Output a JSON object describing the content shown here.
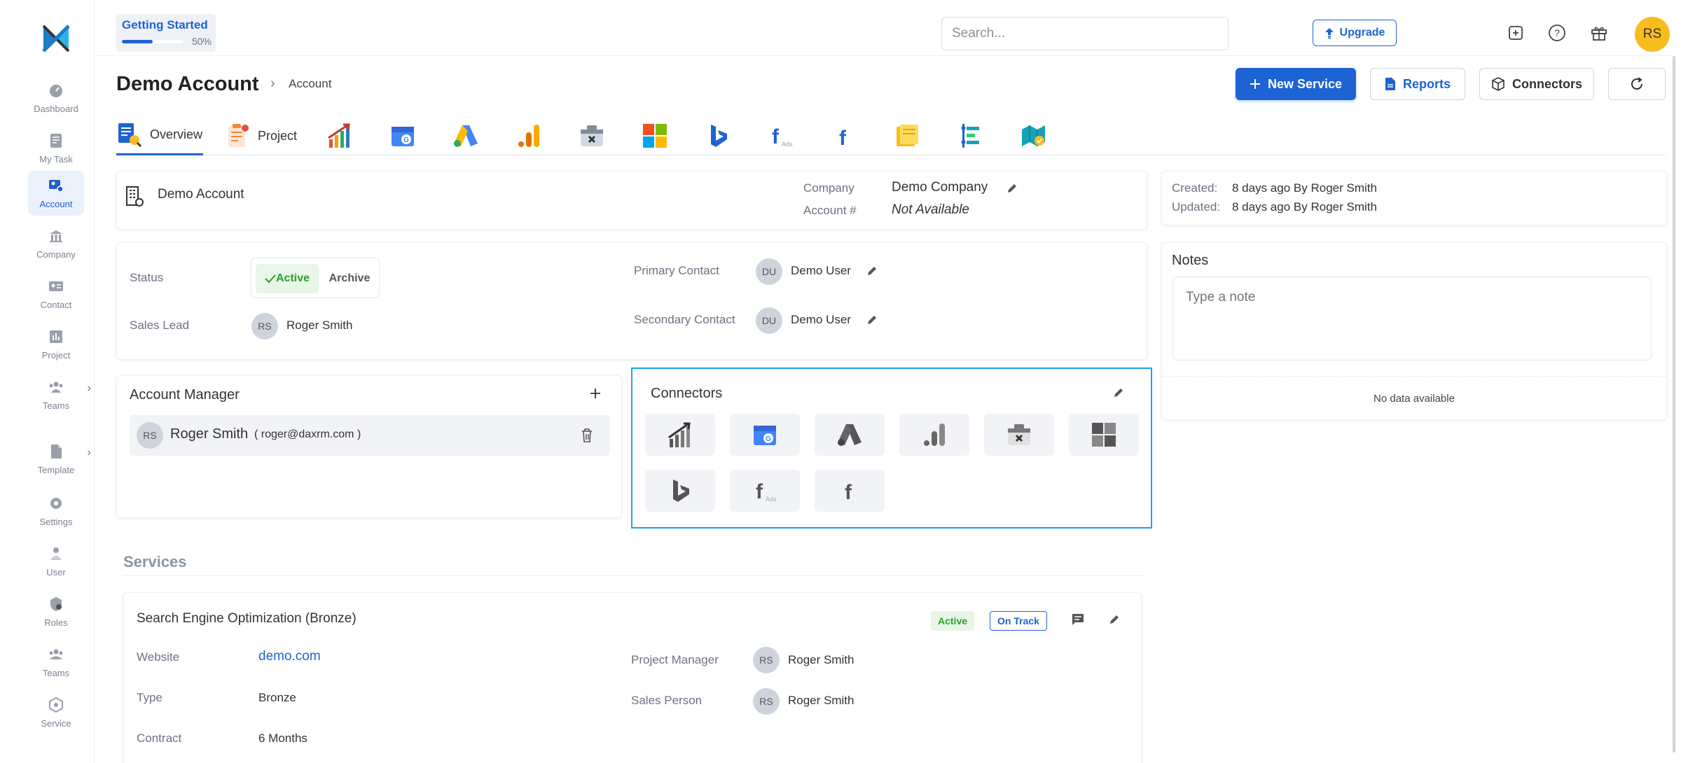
{
  "sidebar": {
    "items": [
      {
        "label": "Dashboard",
        "icon": "dashboard-icon",
        "active": false,
        "arrow": false
      },
      {
        "label": "My Task",
        "icon": "task-icon",
        "active": false,
        "arrow": false
      },
      {
        "label": "Account",
        "icon": "account-icon",
        "active": true,
        "arrow": false
      },
      {
        "label": "Company",
        "icon": "company-icon",
        "active": false,
        "arrow": false
      },
      {
        "label": "Contact",
        "icon": "contact-icon",
        "active": false,
        "arrow": false
      },
      {
        "label": "Project",
        "icon": "project-icon",
        "active": false,
        "arrow": false
      },
      {
        "label": "Teams",
        "icon": "teams-icon",
        "active": false,
        "arrow": true
      },
      {
        "label": "Template",
        "icon": "template-icon",
        "active": false,
        "arrow": true
      },
      {
        "label": "Settings",
        "icon": "settings-icon",
        "active": false,
        "arrow": false
      },
      {
        "label": "User",
        "icon": "user-icon",
        "active": false,
        "arrow": false
      },
      {
        "label": "Roles",
        "icon": "roles-icon",
        "active": false,
        "arrow": false
      },
      {
        "label": "Teams",
        "icon": "teams-icon",
        "active": false,
        "arrow": false
      },
      {
        "label": "Service",
        "icon": "service-icon",
        "active": false,
        "arrow": false
      }
    ]
  },
  "topbar": {
    "getting_started": {
      "title": "Getting Started",
      "progress": "50%"
    },
    "search_placeholder": "Search...",
    "upgrade_label": "Upgrade",
    "user_initials": "RS"
  },
  "page": {
    "title": "Demo Account",
    "breadcrumb_sep": "›",
    "breadcrumb": "Account",
    "buttons": {
      "new_service": "New Service",
      "reports": "Reports",
      "connectors": "Connectors"
    }
  },
  "tabs": [
    {
      "label": "Overview",
      "icon": "overview-icon",
      "active": true
    },
    {
      "label": "Project",
      "icon": "project-clipboard-icon",
      "active": false
    },
    {
      "label": "",
      "icon": "analytics-growth-icon"
    },
    {
      "label": "",
      "icon": "google-business-icon"
    },
    {
      "label": "",
      "icon": "google-ads-icon"
    },
    {
      "label": "",
      "icon": "google-analytics-icon"
    },
    {
      "label": "",
      "icon": "tag-manager-icon"
    },
    {
      "label": "",
      "icon": "microsoft-icon"
    },
    {
      "label": "",
      "icon": "bing-icon"
    },
    {
      "label": "",
      "icon": "facebook-ads-icon"
    },
    {
      "label": "",
      "icon": "facebook-icon"
    },
    {
      "label": "",
      "icon": "folder-icon"
    },
    {
      "label": "",
      "icon": "timeline-icon"
    },
    {
      "label": "",
      "icon": "map-icon"
    }
  ],
  "account_card": {
    "name": "Demo Account",
    "company_label": "Company",
    "company_value": "Demo Company",
    "account_no_label": "Account #",
    "account_no_value": "Not Available"
  },
  "meta_card": {
    "created_label": "Created:",
    "created_value": "8 days ago By Roger Smith",
    "updated_label": "Updated:",
    "updated_value": "8 days ago By Roger Smith"
  },
  "details_card": {
    "status_label": "Status",
    "status_active": "Active",
    "status_archive": "Archive",
    "sales_lead_label": "Sales Lead",
    "sales_lead_initials": "RS",
    "sales_lead_name": "Roger Smith",
    "primary_contact_label": "Primary Contact",
    "primary_contact_initials": "DU",
    "primary_contact_name": "Demo User",
    "secondary_contact_label": "Secondary Contact",
    "secondary_contact_initials": "DU",
    "secondary_contact_name": "Demo User"
  },
  "notes_card": {
    "title": "Notes",
    "placeholder": "Type a note",
    "empty": "No data available"
  },
  "account_manager": {
    "title": "Account Manager",
    "initials": "RS",
    "name": "Roger Smith",
    "email": "( roger@daxrm.com )"
  },
  "connectors_card": {
    "title": "Connectors",
    "tiles": [
      "analytics-growth-icon",
      "google-business-icon",
      "google-ads-icon",
      "google-analytics-icon",
      "tag-manager-icon",
      "microsoft-icon",
      "bing-icon",
      "facebook-ads-icon",
      "facebook-icon"
    ]
  },
  "services": {
    "section_title": "Services",
    "item": {
      "name": "Search Engine Optimization (Bronze)",
      "status_badge": "Active",
      "track_badge": "On Track",
      "website_label": "Website",
      "website_value": "demo.com",
      "type_label": "Type",
      "type_value": "Bronze",
      "contract_label": "Contract",
      "contract_value": "6 Months",
      "pm_label": "Project Manager",
      "pm_initials": "RS",
      "pm_name": "Roger Smith",
      "sp_label": "Sales Person",
      "sp_initials": "RS",
      "sp_name": "Roger Smith"
    }
  },
  "colors": {
    "accent": "#1e63d3",
    "active_green": "#2aa02a",
    "avatar_yellow": "#f8bd1c",
    "highlight_border": "#1da1f2"
  }
}
